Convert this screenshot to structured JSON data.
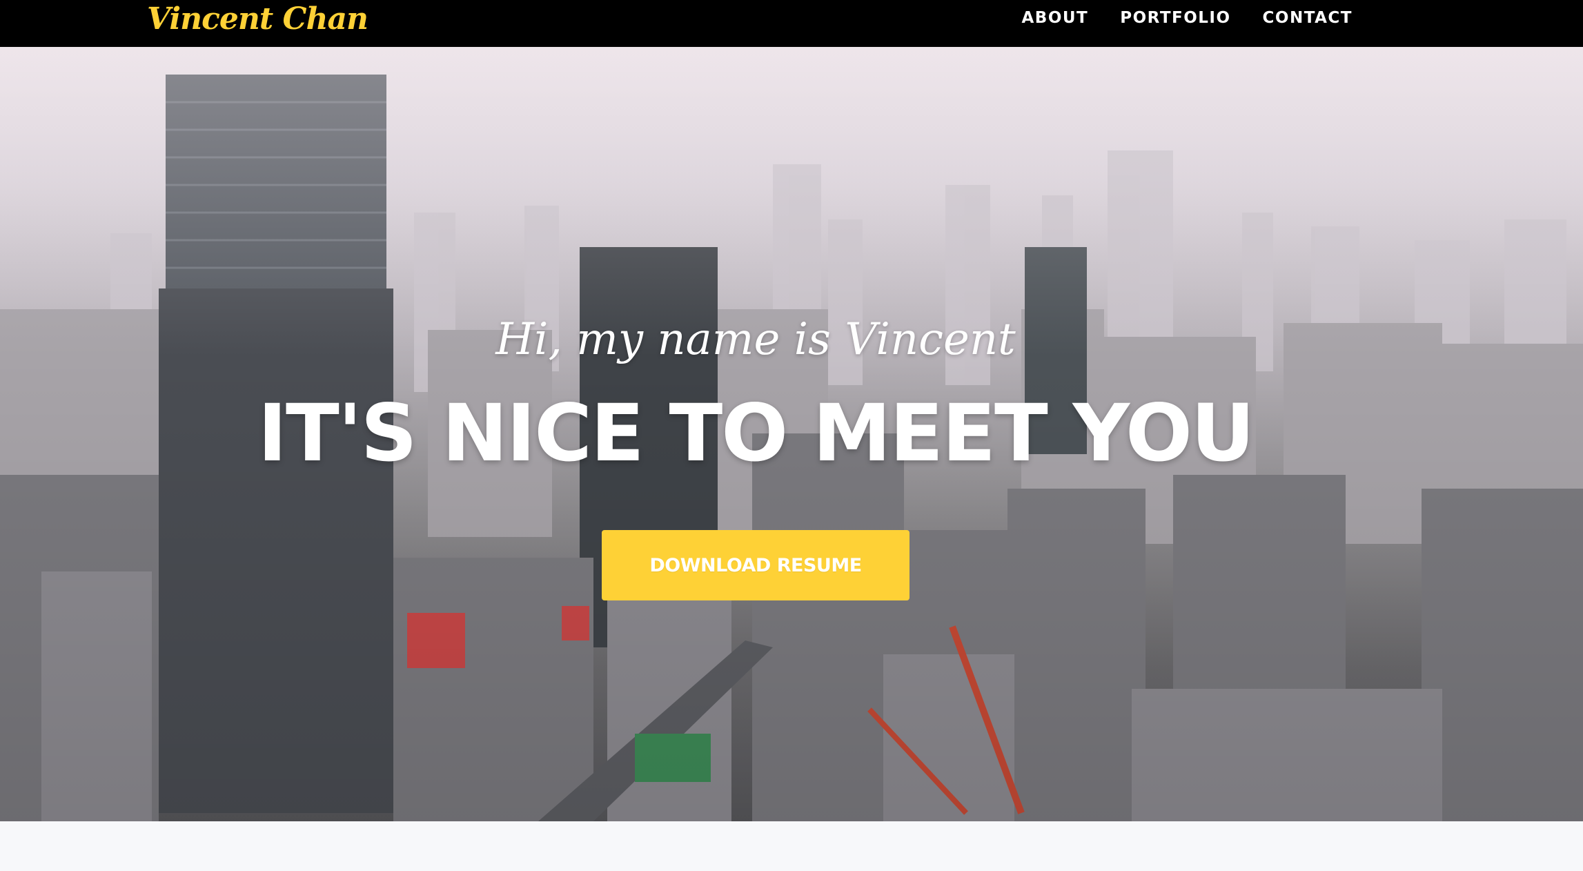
{
  "navbar": {
    "brand": "Vincent Chan",
    "links": [
      {
        "label": "ABOUT"
      },
      {
        "label": "PORTFOLIO"
      },
      {
        "label": "CONTACT"
      }
    ]
  },
  "hero": {
    "subheading": "Hi, my name is Vincent",
    "heading": "IT'S NICE TO MEET YOU",
    "button_label": "DOWNLOAD RESUME",
    "background_image": "city-skyline-photo"
  },
  "colors": {
    "accent": "#fed136",
    "navbar_bg": "#000000",
    "page_bg": "#f7f8fa",
    "text": "#ffffff"
  }
}
